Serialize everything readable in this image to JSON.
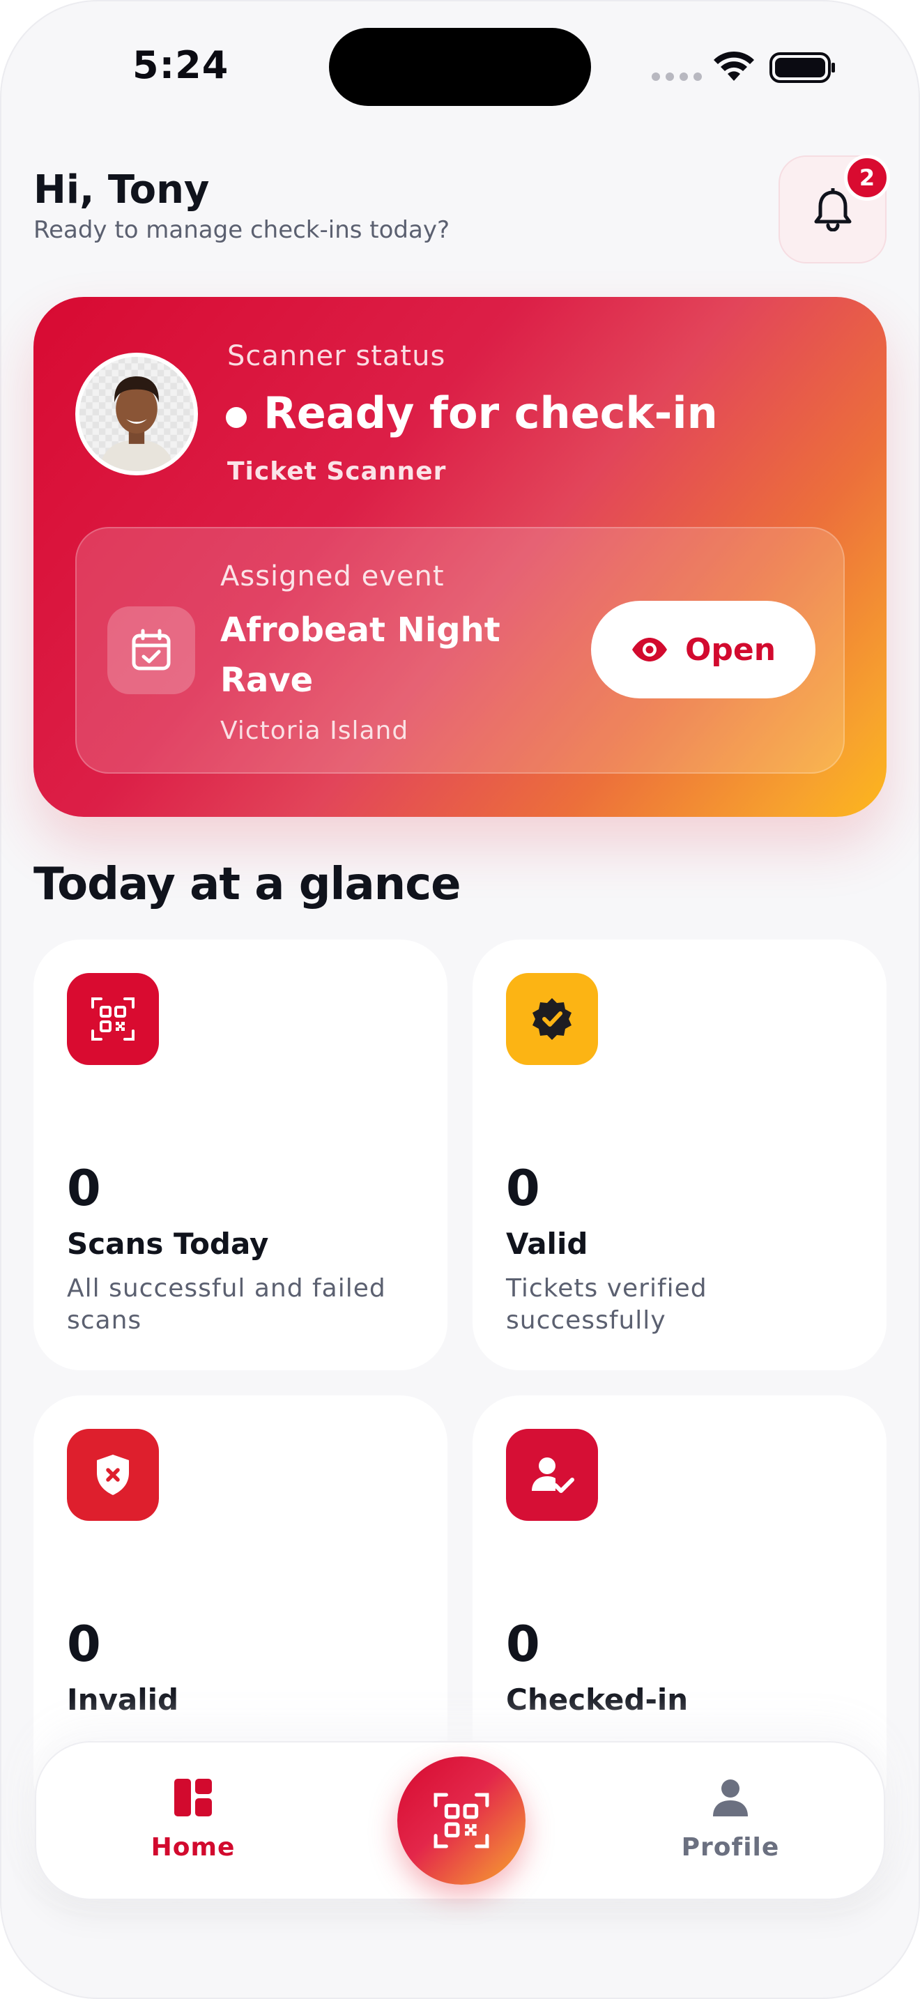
{
  "status_bar": {
    "time": "5:24"
  },
  "header": {
    "greeting": "Hi, Tony",
    "subtitle": "Ready to manage check-ins today?",
    "notification_count": "2"
  },
  "scanner_card": {
    "status_label": "Scanner status",
    "status_value": "Ready for check-in",
    "role": "Ticket Scanner",
    "event": {
      "label": "Assigned event",
      "name": "Afrobeat Night Rave",
      "location": "Victoria Island",
      "open_label": "Open"
    }
  },
  "glance": {
    "title": "Today at a glance",
    "cards": [
      {
        "value": "0",
        "title": "Scans Today",
        "desc": "All successful and failed scans",
        "icon": "qr-scan-icon",
        "color": "#d90b30"
      },
      {
        "value": "0",
        "title": "Valid",
        "desc": "Tickets verified successfully",
        "icon": "verified-badge-icon",
        "color": "#fcb414"
      },
      {
        "value": "0",
        "title": "Invalid",
        "desc": "",
        "icon": "shield-x-icon",
        "color": "#de1f2d"
      },
      {
        "value": "0",
        "title": "Checked-in",
        "desc": "",
        "icon": "user-check-icon",
        "color": "#d60f35"
      }
    ]
  },
  "bottom_nav": {
    "home_label": "Home",
    "profile_label": "Profile",
    "active_color": "#d20a2e",
    "inactive_color": "#6b7080"
  }
}
